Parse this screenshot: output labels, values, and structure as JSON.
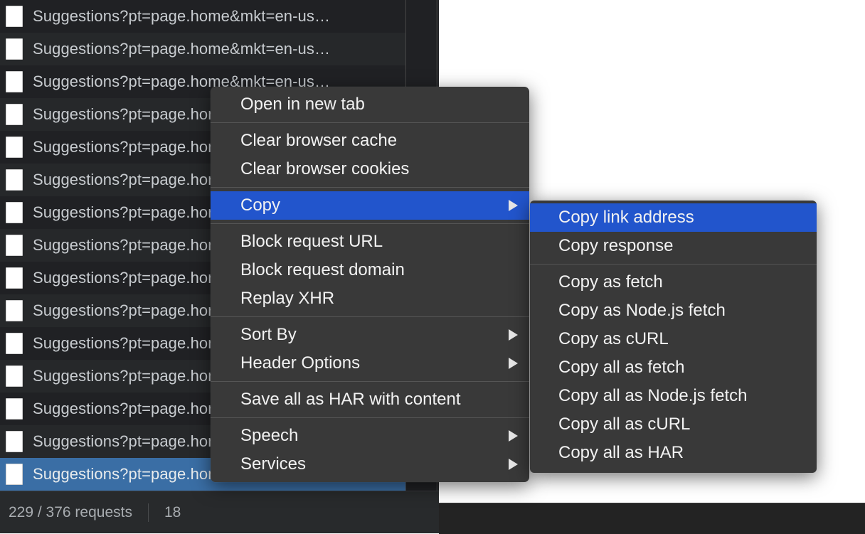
{
  "network_panel": {
    "requests": [
      {
        "name": "Suggestions?pt=page.home&mkt=en-us…",
        "selected": false
      },
      {
        "name": "Suggestions?pt=page.home&mkt=en-us…",
        "selected": false
      },
      {
        "name": "Suggestions?pt=page.home&mkt=en-us…",
        "selected": false
      },
      {
        "name": "Suggestions?pt=page.home&mkt=en-us…",
        "selected": false
      },
      {
        "name": "Suggestions?pt=page.home&mkt=en-us…",
        "selected": false
      },
      {
        "name": "Suggestions?pt=page.home&mkt=en-us…",
        "selected": false
      },
      {
        "name": "Suggestions?pt=page.home&mkt=en-us…",
        "selected": false
      },
      {
        "name": "Suggestions?pt=page.home&mkt=en-us…",
        "selected": false
      },
      {
        "name": "Suggestions?pt=page.home&mkt=en-us…",
        "selected": false
      },
      {
        "name": "Suggestions?pt=page.home&mkt=en-us…",
        "selected": false
      },
      {
        "name": "Suggestions?pt=page.home&mkt=en-us…",
        "selected": false
      },
      {
        "name": "Suggestions?pt=page.home&mkt=en-us…",
        "selected": false
      },
      {
        "name": "Suggestions?pt=page.home&mkt=en-us…",
        "selected": false
      },
      {
        "name": "Suggestions?pt=page.home&mkt=en-us…",
        "selected": false
      },
      {
        "name": "Suggestions?pt=page.home&mkt=en-us…",
        "selected": true
      }
    ]
  },
  "status_bar": {
    "requests": "229 / 376 requests",
    "transferred": "18"
  },
  "context_menu": {
    "groups": [
      {
        "items": [
          {
            "label": "Open in new tab",
            "submenu": false,
            "highlight": false
          }
        ]
      },
      {
        "items": [
          {
            "label": "Clear browser cache",
            "submenu": false,
            "highlight": false
          },
          {
            "label": "Clear browser cookies",
            "submenu": false,
            "highlight": false
          }
        ]
      },
      {
        "items": [
          {
            "label": "Copy",
            "submenu": true,
            "highlight": true
          }
        ]
      },
      {
        "items": [
          {
            "label": "Block request URL",
            "submenu": false,
            "highlight": false
          },
          {
            "label": "Block request domain",
            "submenu": false,
            "highlight": false
          },
          {
            "label": "Replay XHR",
            "submenu": false,
            "highlight": false
          }
        ]
      },
      {
        "items": [
          {
            "label": "Sort By",
            "submenu": true,
            "highlight": false
          },
          {
            "label": "Header Options",
            "submenu": true,
            "highlight": false
          }
        ]
      },
      {
        "items": [
          {
            "label": "Save all as HAR with content",
            "submenu": false,
            "highlight": false
          }
        ]
      },
      {
        "items": [
          {
            "label": "Speech",
            "submenu": true,
            "highlight": false
          },
          {
            "label": "Services",
            "submenu": true,
            "highlight": false
          }
        ]
      }
    ]
  },
  "copy_submenu": {
    "groups": [
      {
        "items": [
          {
            "label": "Copy link address",
            "highlight": true
          },
          {
            "label": "Copy response",
            "highlight": false
          }
        ]
      },
      {
        "items": [
          {
            "label": "Copy as fetch",
            "highlight": false
          },
          {
            "label": "Copy as Node.js fetch",
            "highlight": false
          },
          {
            "label": "Copy as cURL",
            "highlight": false
          },
          {
            "label": "Copy all as fetch",
            "highlight": false
          },
          {
            "label": "Copy all as Node.js fetch",
            "highlight": false
          },
          {
            "label": "Copy all as cURL",
            "highlight": false
          },
          {
            "label": "Copy all as HAR",
            "highlight": false
          }
        ]
      }
    ]
  },
  "colors": {
    "menu_background": "#393939",
    "menu_highlight": "#2255cc",
    "row_selected": "#3a6ea5",
    "panel_background": "#202124"
  }
}
